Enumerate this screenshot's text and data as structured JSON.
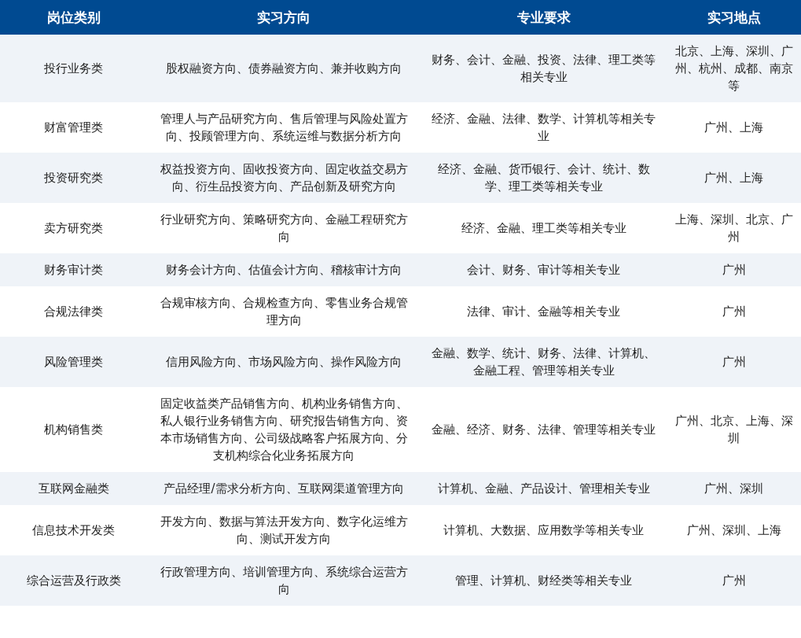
{
  "table": {
    "columns": [
      "岗位类别",
      "实习方向",
      "专业要求",
      "实习地点"
    ],
    "rows": [
      [
        "投行业务类",
        "股权融资方向、债券融资方向、兼并收购方向",
        "财务、会计、金融、投资、法律、理工类等相关专业",
        "北京、上海、深圳、广州、杭州、成都、南京等"
      ],
      [
        "财富管理类",
        "管理人与产品研究方向、售后管理与风险处置方向、投顾管理方向、系统运维与数据分析方向",
        "经济、金融、法律、数学、计算机等相关专业",
        "广州、上海"
      ],
      [
        "投资研究类",
        "权益投资方向、固收投资方向、固定收益交易方向、衍生品投资方向、产品创新及研究方向",
        "经济、金融、货币银行、会计、统计、数学、理工类等相关专业",
        "广州、上海"
      ],
      [
        "卖方研究类",
        "行业研究方向、策略研究方向、金融工程研究方向",
        "经济、金融、理工类等相关专业",
        "上海、深圳、北京、广州"
      ],
      [
        "财务审计类",
        "财务会计方向、估值会计方向、稽核审计方向",
        "会计、财务、审计等相关专业",
        "广州"
      ],
      [
        "合规法律类",
        "合规审核方向、合规检查方向、零售业务合规管理方向",
        "法律、审计、金融等相关专业",
        "广州"
      ],
      [
        "风险管理类",
        "信用风险方向、市场风险方向、操作风险方向",
        "金融、数学、统计、财务、法律、计算机、金融工程、管理等相关专业",
        "广州"
      ],
      [
        "机构销售类",
        "固定收益类产品销售方向、机构业务销售方向、私人银行业务销售方向、研究报告销售方向、资本市场销售方向、公司级战略客户拓展方向、分支机构综合化业务拓展方向",
        "金融、经济、财务、法律、管理等相关专业",
        "广州、北京、上海、深圳"
      ],
      [
        "互联网金融类",
        "产品经理/需求分析方向、互联网渠道管理方向",
        "计算机、金融、产品设计、管理相关专业",
        "广州、深圳"
      ],
      [
        "信息技术开发类",
        "开发方向、数据与算法开发方向、数字化运维方向、测试开发方向",
        "计算机、大数据、应用数学等相关专业",
        "广州、深圳、上海"
      ],
      [
        "综合运营及行政类",
        "行政管理方向、培训管理方向、系统综合运营方向",
        "管理、计算机、财经类等相关专业",
        "广州"
      ]
    ]
  }
}
